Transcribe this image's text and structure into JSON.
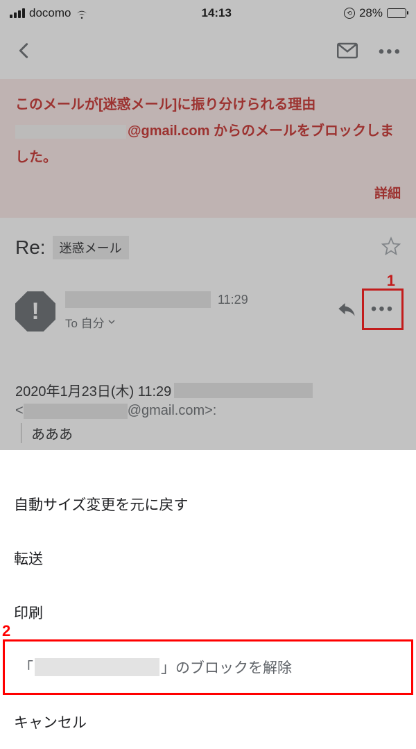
{
  "status": {
    "carrier": "docomo",
    "time": "14:13",
    "battery_percent": "28%",
    "battery_level": 28
  },
  "spam_banner": {
    "reason_title": "このメールが[迷惑メール]に振り分けられる理由",
    "email_suffix": "@gmail.com からのメールをブロックしました。",
    "detail_link": "詳細"
  },
  "subject": {
    "prefix": "Re:",
    "label": "迷惑メール"
  },
  "message": {
    "time": "11:29",
    "to_label": "To 自分"
  },
  "body": {
    "date_line": "2020年1月23日(木) 11:29",
    "email_domain": "@gmail.com",
    "quoted_text": "あああ"
  },
  "sheet": {
    "item_autosize": "自動サイズ変更を元に戻す",
    "item_forward": "転送",
    "item_print": "印刷",
    "item_unblock_prefix": "「",
    "item_unblock_suffix": "」のブロックを解除",
    "item_cancel": "キャンセル"
  },
  "annotations": {
    "a1": "1",
    "a2": "2"
  }
}
